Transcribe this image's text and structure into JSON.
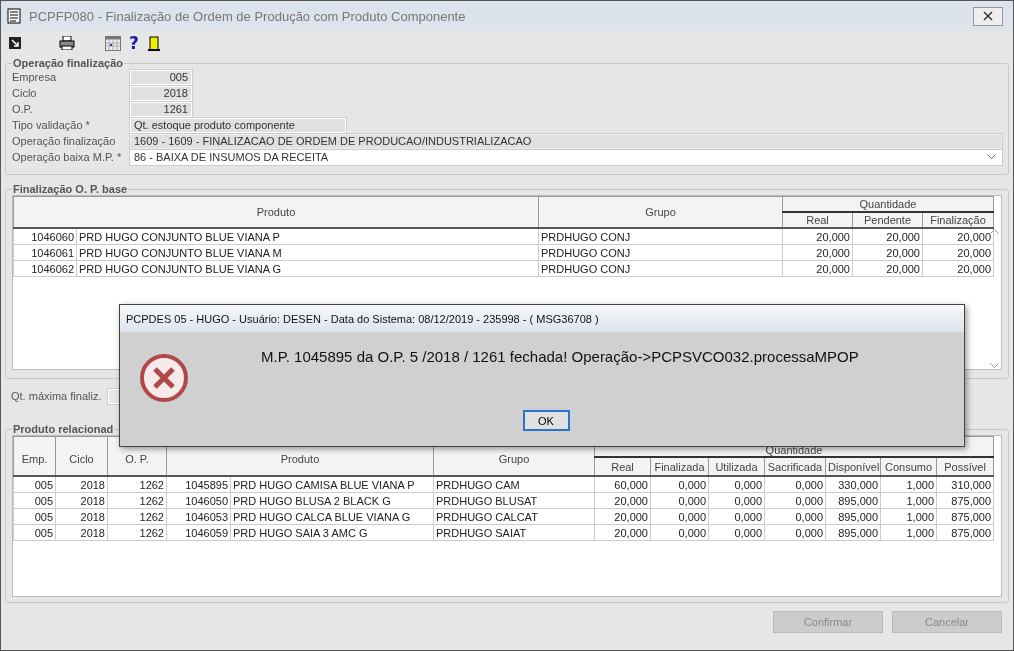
{
  "window": {
    "title": "PCPFP080 - Finalização de Ordem de Produção com Produto Componente"
  },
  "toolbar": {
    "help_glyph": "?"
  },
  "operacao": {
    "title": "Operação finalização",
    "fields": [
      {
        "label": "Empresa",
        "value": "005",
        "kind": "number"
      },
      {
        "label": "Ciclo",
        "value": "2018",
        "kind": "number"
      },
      {
        "label": "O.P.",
        "value": "1261",
        "kind": "number"
      },
      {
        "label": "Tipo validação *",
        "value": "Qt. estoque produto componente",
        "kind": "medium"
      },
      {
        "label": "Operação finalização",
        "value": "1609 - 1609 - FINALIZACAO DE ORDEM DE PRODUCAO/INDUSTRIALIZACAO",
        "kind": "wide"
      },
      {
        "label": "Operação baixa M.P. *",
        "value": "86 - BAIXA DE INSUMOS DA RECEITA",
        "kind": "combo"
      }
    ]
  },
  "base": {
    "title": "Finalização O. P. base",
    "columns": [
      "Produto",
      "Grupo"
    ],
    "group_header": "Quantidade",
    "sub_columns": [
      "Real",
      "Pendente",
      "Finalização"
    ],
    "rows": [
      {
        "code": "1046060",
        "product": "PRD HUGO CONJUNTO BLUE VIANA P",
        "group": "PRDHUGO CONJ",
        "values": [
          "20,000",
          "20,000",
          "20,000"
        ]
      },
      {
        "code": "1046061",
        "product": "PRD HUGO CONJUNTO BLUE VIANA M",
        "group": "PRDHUGO CONJ",
        "values": [
          "20,000",
          "20,000",
          "20,000"
        ]
      },
      {
        "code": "1046062",
        "product": "PRD HUGO CONJUNTO BLUE VIANA G",
        "group": "PRDHUGO CONJ",
        "values": [
          "20,000",
          "20,000",
          "20,000"
        ]
      }
    ]
  },
  "qt_maxima": {
    "label": "Qt. máxima finaliz."
  },
  "relacionado": {
    "title": "Produto relacionad",
    "columns": [
      "Emp.",
      "Ciclo",
      "O. P.",
      "Produto",
      "Grupo"
    ],
    "group_header": "Quantidade",
    "sub_columns": [
      "Real",
      "Finalizada",
      "Utilizada",
      "Sacrificada",
      "Disponível",
      "Consumo",
      "Possível"
    ],
    "rows": [
      {
        "emp": "005",
        "ciclo": "2018",
        "op": "1262",
        "code": "1045895",
        "product": "PRD HUGO CAMISA BLUE VIANA P",
        "group": "PRDHUGO CAM",
        "values": [
          "60,000",
          "0,000",
          "0,000",
          "0,000",
          "330,000",
          "1,000",
          "310,000"
        ]
      },
      {
        "emp": "005",
        "ciclo": "2018",
        "op": "1262",
        "code": "1046050",
        "product": "PRD HUGO BLUSA 2 BLACK G",
        "group": "PRDHUGO BLUSAT",
        "values": [
          "20,000",
          "0,000",
          "0,000",
          "0,000",
          "895,000",
          "1,000",
          "875,000"
        ]
      },
      {
        "emp": "005",
        "ciclo": "2018",
        "op": "1262",
        "code": "1046053",
        "product": "PRD HUGO CALCA BLUE VIANA G",
        "group": "PRDHUGO CALCAT",
        "values": [
          "20,000",
          "0,000",
          "0,000",
          "0,000",
          "895,000",
          "1,000",
          "875,000"
        ]
      },
      {
        "emp": "005",
        "ciclo": "2018",
        "op": "1262",
        "code": "1046059",
        "product": "PRD HUGO SAIA 3 AMC G",
        "group": "PRDHUGO SAIAT",
        "values": [
          "20,000",
          "0,000",
          "0,000",
          "0,000",
          "895,000",
          "1,000",
          "875,000"
        ]
      }
    ]
  },
  "buttons": [
    {
      "label": "Confirmar",
      "disabled": true
    },
    {
      "label": "Cancelar",
      "disabled": true
    }
  ],
  "dialog": {
    "title": "PCPDES 05 - HUGO - Usuário: DESEN - Data do Sistema: 08/12/2019 - 235998 - ( MSG36708 )",
    "message": "M.P. 1045895 da O.P. 5 /2018 / 1261 fechada! Operação->PCPSVCO032.processaMPOP",
    "button": "OK"
  }
}
